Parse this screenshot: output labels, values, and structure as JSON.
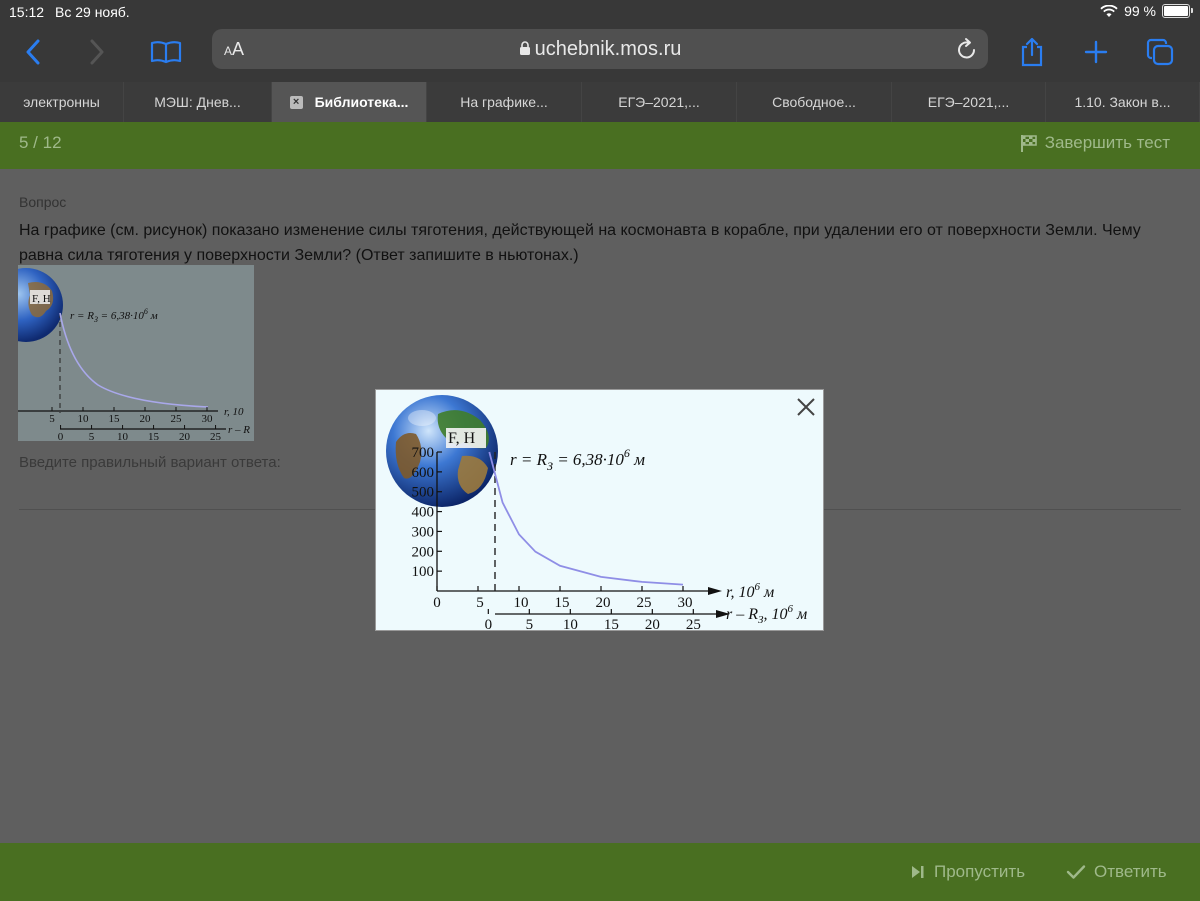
{
  "status": {
    "time": "15:12",
    "date": "Вс 29 нояб.",
    "battery": "99 %"
  },
  "browser": {
    "aa_small": "A",
    "aa_large": "A",
    "url": "uchebnik.mos.ru"
  },
  "tabs": [
    {
      "label": "электронны",
      "active": false
    },
    {
      "label": "МЭШ: Днев...",
      "active": false
    },
    {
      "label": "Библиотека...",
      "active": true
    },
    {
      "label": "На графике...",
      "active": false
    },
    {
      "label": "ЕГЭ–2021,...",
      "active": false
    },
    {
      "label": "Свободное...",
      "active": false
    },
    {
      "label": "ЕГЭ–2021,...",
      "active": false
    },
    {
      "label": "1.10. Закон в...",
      "active": false
    }
  ],
  "test": {
    "counter": "5 / 12",
    "finish_label": "Завершить тест"
  },
  "question": {
    "label": "Вопрос",
    "text": "На графике (см. рисунок) показано изменение силы тяготения, действующей на космонавта в корабле, при удалении его от поверхности Земли. Чему равна сила тяготения у поверхности Земли? (Ответ запишите в ньютонах.)",
    "answer_prompt": "Введите правильный вариант ответа:"
  },
  "footer": {
    "skip_label": "Пропустить",
    "answer_label": "Ответить"
  },
  "figure": {
    "y_axis_label": "F, Н",
    "annotation_prefix": "r = R",
    "annotation_sub": "З",
    "annotation_value": " = 6,38·10",
    "annotation_exp": "6",
    "annotation_unit": " м",
    "y_ticks": [
      "700",
      "600",
      "500",
      "400",
      "300",
      "200",
      "100"
    ],
    "x_ticks": [
      "0",
      "5",
      "10",
      "15",
      "20",
      "25",
      "30"
    ],
    "x_label": "r, 10",
    "x_label_exp": "6",
    "x_label_unit": " м",
    "x2_ticks": [
      "0",
      "5",
      "10",
      "15",
      "20",
      "25"
    ],
    "x2_label": "r – R",
    "x2_label_sub": "З",
    "x2_label_mid": ", 10",
    "x2_label_exp": "6",
    "x2_label_unit": " м",
    "thumb_x_label": "r, 10",
    "thumb_x2_label": "r – R"
  },
  "chart_data": {
    "type": "line",
    "xlabel": "r, 10^6 м",
    "ylabel": "F, Н",
    "x2label": "r – R_З, 10^6 м",
    "xlim": [
      0,
      30
    ],
    "ylim": [
      0,
      700
    ],
    "series": [
      {
        "x": [
          6.38,
          8,
          10,
          12,
          15,
          20,
          25,
          30
        ],
        "values": [
          700,
          445,
          285,
          198,
          127,
          71,
          46,
          32
        ]
      }
    ],
    "annotations": [
      "r = R_З = 6,38·10^6 м"
    ],
    "grid": false,
    "colors": {
      "curve": "#8f8ee6",
      "axis": "#111111"
    }
  }
}
